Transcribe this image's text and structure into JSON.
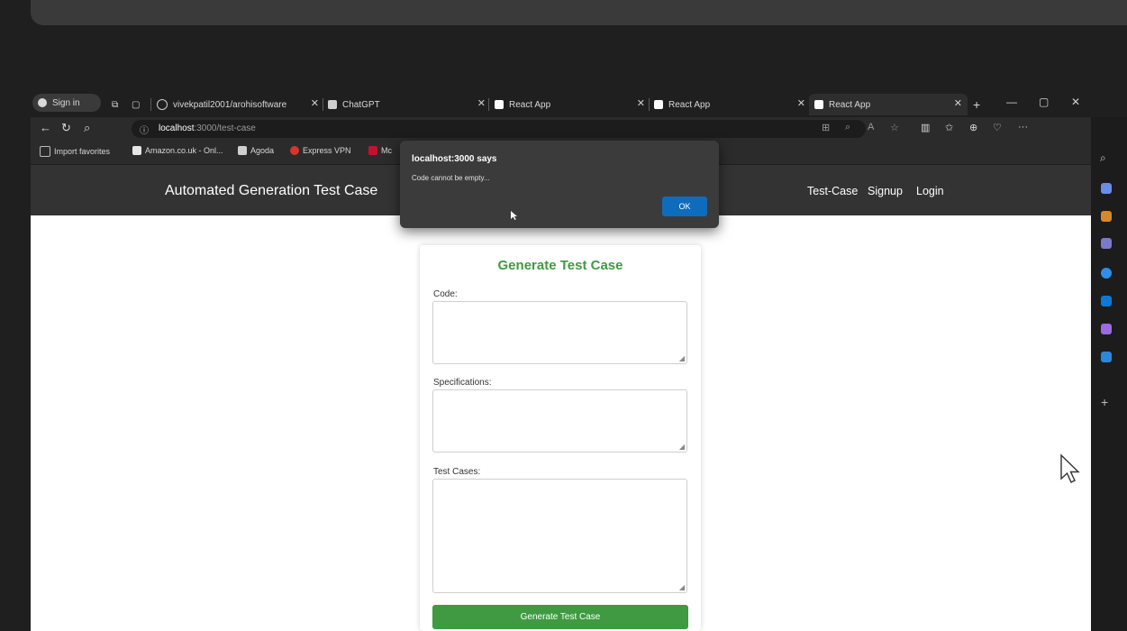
{
  "browser": {
    "signin_label": "Sign in",
    "tabs": [
      {
        "label": "vivekpatil2001/arohisoftware",
        "icon": "github-icon"
      },
      {
        "label": "ChatGPT",
        "icon": "chatgpt-icon"
      },
      {
        "label": "React App",
        "icon": "react-icon"
      },
      {
        "label": "React App",
        "icon": "react-icon"
      },
      {
        "label": "React App",
        "icon": "react-icon",
        "active": true
      }
    ],
    "new_tab": "+",
    "url_host": "localhost",
    "url_rest": ":3000/test-case",
    "favorites": [
      {
        "label": "Import favorites",
        "icon": "import-icon"
      },
      {
        "label": "Amazon.co.uk - Onl...",
        "icon": "amazon-icon"
      },
      {
        "label": "Agoda",
        "icon": "agoda-icon"
      },
      {
        "label": "Express VPN",
        "icon": "vpn-icon"
      },
      {
        "label": "Mc",
        "icon": "mcafee-icon"
      }
    ]
  },
  "app": {
    "brand": "Automated Generation Test Case",
    "nav": [
      "Test-Case",
      "Signup",
      "Login"
    ],
    "card": {
      "title": "Generate Test Case",
      "code_label": "Code:",
      "specs_label": "Specifications:",
      "cases_label": "Test Cases:",
      "button": "Generate Test Case"
    }
  },
  "dialog": {
    "title": "localhost:3000 says",
    "message": "Code cannot be empty...",
    "ok": "OK"
  },
  "colors": {
    "accent_green": "#3f9a41",
    "dialog_button": "#0f6cbd",
    "nav_bg": "#333333"
  }
}
